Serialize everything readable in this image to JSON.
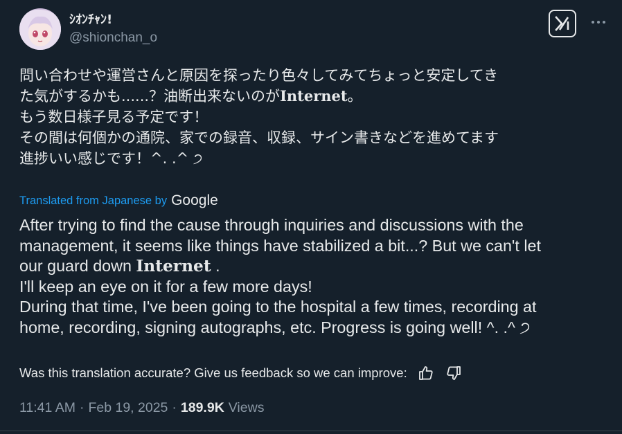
{
  "author": {
    "display_name": "ｼｵﾝﾁｬﾝ!",
    "handle": "@shionchan_o"
  },
  "tweet": {
    "original_text_parts": [
      "問い合わせや運営さんと原因を探ったり色々してみてちょっと安定してき\nた気がするかも......？油断出来ないのが",
      "Internet",
      "。\nもう数日様子見る予定です！\nその間は何個かの通院、家での録音、収録、サイン書きなどを進めてます\n進捗いい感じです！^. .^ ੭"
    ],
    "translated_label": "Translated from Japanese by",
    "translator": "Google",
    "translated_text_parts": [
      "After trying to find the cause through inquiries and discussions with the\nmanagement, it seems like things have stabilized a bit...? But we can't let\nour guard down ",
      "Internet",
      " .\nI'll keep an eye on it for a few more days!\nDuring that time, I've been going to the hospital a few times, recording at\nhome, recording, signing autographs, etc. Progress is going well! ^. .^ ੭"
    ]
  },
  "feedback": {
    "prompt": "Was this translation accurate? Give us feedback so we can improve:"
  },
  "meta": {
    "time": "11:41 AM",
    "sep1": "·",
    "date": "Feb 19, 2025",
    "sep2": "·",
    "views_count": "189.9K",
    "views_label": "Views"
  },
  "colors": {
    "background": "#15202b",
    "text": "#e7e9ea",
    "muted": "#8b98a5",
    "link": "#1d9bf0"
  },
  "icons": [
    "avatar",
    "grok-icon",
    "more-icon",
    "thumbs-up-icon",
    "thumbs-down-icon"
  ]
}
